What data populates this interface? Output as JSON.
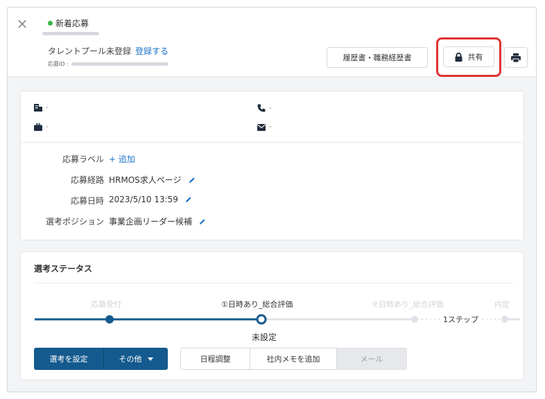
{
  "header": {
    "status": "新着応募",
    "talent_pool_text": "タレントプール未登録",
    "register_link": "登録する",
    "application_id_label": "応募ID :",
    "resume_button": "履歴書・職務経歴書",
    "share_button": "共有"
  },
  "contact": {
    "company": "-",
    "phone": "-",
    "job": "-",
    "email": "-"
  },
  "fields": {
    "label_label": "応募ラベル",
    "add_label": "+ 追加",
    "route_label": "応募経路",
    "route_value": "HRMOS求人ページ",
    "date_label": "応募日時",
    "date_value": "2023/5/10 13:59",
    "position_label": "選考ポジション",
    "position_value": "事業企画リーダー候補"
  },
  "selection": {
    "title": "選考ステータス",
    "steps": [
      {
        "label": "応募受付",
        "state": "done"
      },
      {
        "label": "①日時あり_総合評価",
        "state": "current"
      },
      {
        "label": "②日時あり_総合評価",
        "state": "upcoming"
      },
      {
        "label": "内定",
        "state": "upcoming"
      }
    ],
    "skip_label": "1ステップ",
    "current_status": "未設定"
  },
  "actions": {
    "set_selection": "選考を設定",
    "other": "その他",
    "schedule": "日程調整",
    "add_memo": "社内メモを追加",
    "mail": "メール"
  },
  "colors": {
    "primary": "#145a8e",
    "link": "#1a73c8",
    "new_dot": "#3bb54a",
    "highlight": "#e03131"
  }
}
